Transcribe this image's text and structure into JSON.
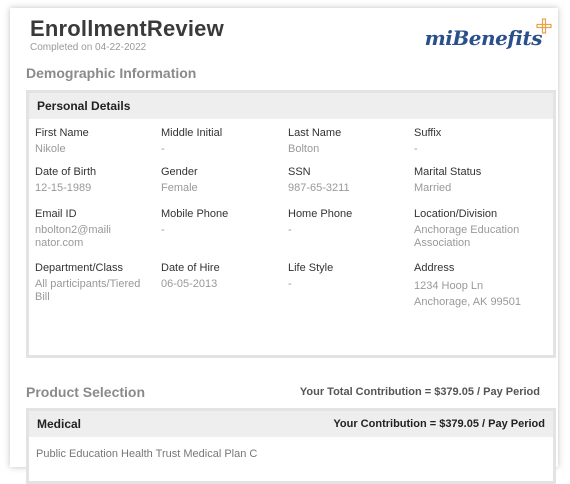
{
  "header": {
    "title": "EnrollmentReview",
    "completed": "Completed on 04-22-2022",
    "logo_mi": "mi",
    "logo_benefits": "Benefits"
  },
  "demographic": {
    "section_title": "Demographic Information",
    "panel_title": "Personal Details",
    "fields": [
      {
        "label": "First Name",
        "value": "Nikole"
      },
      {
        "label": "Middle Initial",
        "value": "-"
      },
      {
        "label": "Last Name",
        "value": "Bolton"
      },
      {
        "label": "Suffix",
        "value": "-"
      },
      {
        "label": "Date of Birth",
        "value": "12-15-1989"
      },
      {
        "label": "Gender",
        "value": "Female"
      },
      {
        "label": "SSN",
        "value": "987-65-3211"
      },
      {
        "label": "Marital Status",
        "value": "Married"
      },
      {
        "label": "Email ID",
        "value": "nbolton2@mailinator.com"
      },
      {
        "label": "Mobile Phone",
        "value": "-"
      },
      {
        "label": "Home Phone",
        "value": "-"
      },
      {
        "label": "Location/Division",
        "value": "Anchorage Education Association"
      },
      {
        "label": "Department/Class",
        "value": "All participants/Tiered Bill"
      },
      {
        "label": "Date of Hire",
        "value": "06-05-2013"
      },
      {
        "label": "Life Style",
        "value": "-"
      },
      {
        "label": "Address",
        "value": "1234 Hoop Ln Anchorage, AK 99501"
      }
    ]
  },
  "product": {
    "section_title": "Product Selection",
    "total_contribution": "Your Total Contribution = $379.05 / Pay Period",
    "medical_title": "Medical",
    "medical_contribution": "Your Contribution = $379.05 / Pay Period",
    "plan_name": "Public Education Health Trust Medical Plan C"
  },
  "colors": {
    "logo": "#2a4f8a",
    "logo_plus": "#e8a24a",
    "panel_border": "#e3e3e3",
    "panel_header": "#eeeeee"
  }
}
